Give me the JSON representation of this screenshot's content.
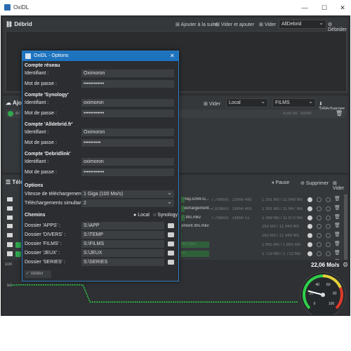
{
  "window": {
    "title": "OxiDL",
    "minimize": "—",
    "maximize": "☐",
    "close": "✕"
  },
  "top_panel": {
    "header": "Débrid",
    "add_next": "Ajouter à la suite",
    "clear_add": "Vider et ajouter",
    "clear": "Vider",
    "service_select": "AllDebrid",
    "download": "Débrider"
  },
  "add_panel": {
    "header": "Ajou",
    "clear": "Vider",
    "location_select": "Local",
    "folder_select": "FILMS",
    "download": "Télécharger",
    "row_count": "47",
    "row_size": "4,56 Go",
    "row_type": "fichier"
  },
  "downloads_panel": {
    "header": "Téléch",
    "pause": "Pause",
    "delete": "Supprimer",
    "clear": "Vider",
    "rows": [
      {
        "name": "uRay.x264-G...",
        "speed": "7,76Mo/s",
        "eta": "23min 48s",
        "size": "1 391 Mo / 11 949 Mo",
        "progress": 0.12,
        "check": false
      },
      {
        "name": "elechargement...",
        "speed": "7,81Mo/s",
        "eta": "16min 40s",
        "size": "1 391 Mo / 11 947 Mo",
        "progress": 0.12,
        "check": false
      },
      {
        "name": "nt.Ws.mkv",
        "speed": "7,76Mo/s",
        "eta": "16min 1s",
        "size": "1 389 Mo / 11 873 Mo",
        "progress": 0.12,
        "check": false
      },
      {
        "name": "ement.Ws.mkv",
        "speed": "",
        "eta": "",
        "size": "263 Mo / 11 949 Mo",
        "progress": 0.02,
        "check": false
      },
      {
        "name": "",
        "speed": "",
        "eta": "",
        "size": "263 Mo / 11 948 Mo",
        "progress": 0.02,
        "check": false
      },
      {
        "name": "Ws.mkv",
        "speed": "",
        "eta": "",
        "size": "1 865 Mo / 1 865 Mo",
        "progress": 1.0,
        "check": true
      },
      {
        "name": "kv",
        "speed": "",
        "eta": "",
        "size": "1 713 Mo / 1 713 Mo",
        "progress": 1.0,
        "check": true
      },
      {
        "name": "Ws.mkv",
        "speed": "",
        "eta": "",
        "size": "7 / 7 Mo",
        "progress": 1.0,
        "check": true
      }
    ]
  },
  "speed_panel": {
    "speed_label": "22,06 Mo/s",
    "y_top": "100",
    "y_mid": "50",
    "gauge_min": "0",
    "gauge_max": "100",
    "gauge_ticks": [
      "20",
      "40",
      "60",
      "80"
    ],
    "gauge_value": 22.06,
    "chart_data": {
      "type": "line",
      "series": [
        {
          "values": [
            55,
            56,
            56,
            56,
            56,
            56,
            56,
            56,
            56,
            56,
            56,
            21,
            21,
            21,
            21,
            21,
            21,
            21,
            21,
            21,
            21,
            21,
            21,
            21,
            21,
            21,
            21,
            21,
            21,
            21,
            21,
            21,
            21,
            21,
            21,
            21,
            21,
            21,
            21,
            21,
            21
          ]
        }
      ],
      "ylim": [
        0,
        100
      ]
    }
  },
  "dialog": {
    "title": "OxiDL - Options",
    "close": "✕",
    "sections": [
      {
        "header": "Compte réseau",
        "id_label": "Identifiant :",
        "id_value": "Oximoron",
        "pw_label": "Mot de passe :",
        "pw_value": "••••••••••••"
      },
      {
        "header": "Compte 'Synology'",
        "id_label": "Identifiant :",
        "id_value": "oximoron",
        "pw_label": "Mot de passe :",
        "pw_value": "••••••••••••"
      },
      {
        "header": "Compte 'Alldebrid.fr'",
        "id_label": "Identifiant :",
        "id_value": "Oximoron",
        "pw_label": "Mot de passe :",
        "pw_value": "••••••••••"
      },
      {
        "header": "Compte 'Debridlink'",
        "id_label": "Identifiant :",
        "id_value": "oximoron",
        "pw_label": "Mot de passe :",
        "pw_value": "••••••••••••"
      }
    ],
    "options": {
      "header": "Options",
      "speed_label": "Vitesse de téléchargement :",
      "speed_value": "1 Giga (100 Mo/s)",
      "simul_label": "Téléchargements simultanés :",
      "simul_value": "2"
    },
    "paths": {
      "header": "Chemins",
      "local": "Local",
      "synology": "Synology",
      "folders": [
        {
          "label": "Dossier 'APPS' :",
          "value": "S:\\APP"
        },
        {
          "label": "Dossier 'DIVERS' :",
          "value": "S:\\TEMP"
        },
        {
          "label": "Dossier 'FILMS' :",
          "value": "S:\\FILMS"
        },
        {
          "label": "Dossier 'JEUX' :",
          "value": "S:\\JEUX"
        },
        {
          "label": "Dossier 'SERIES' :",
          "value": "S:\\SERIES"
        }
      ]
    },
    "validate": "Valider"
  }
}
